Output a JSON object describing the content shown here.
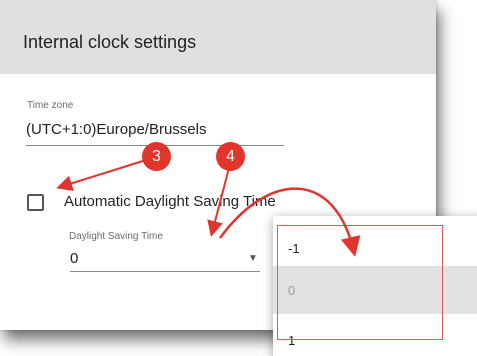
{
  "dialog": {
    "title": "Internal clock settings"
  },
  "time_zone": {
    "label": "Time zone",
    "value": "(UTC+1:0)Europe/Brussels"
  },
  "auto_dst": {
    "label": "Automatic Daylight Saving Time",
    "checked": false
  },
  "dst": {
    "label": "Daylight Saving Time",
    "value": "0"
  },
  "dropdown": {
    "options": [
      "-1",
      "0",
      "1"
    ],
    "highlighted": "0"
  },
  "callouts": [
    "3",
    "4"
  ],
  "colors": {
    "callout": "#e0342c",
    "header_bg": "#e0e0e0",
    "highlight_row": "#e2e2e2"
  }
}
